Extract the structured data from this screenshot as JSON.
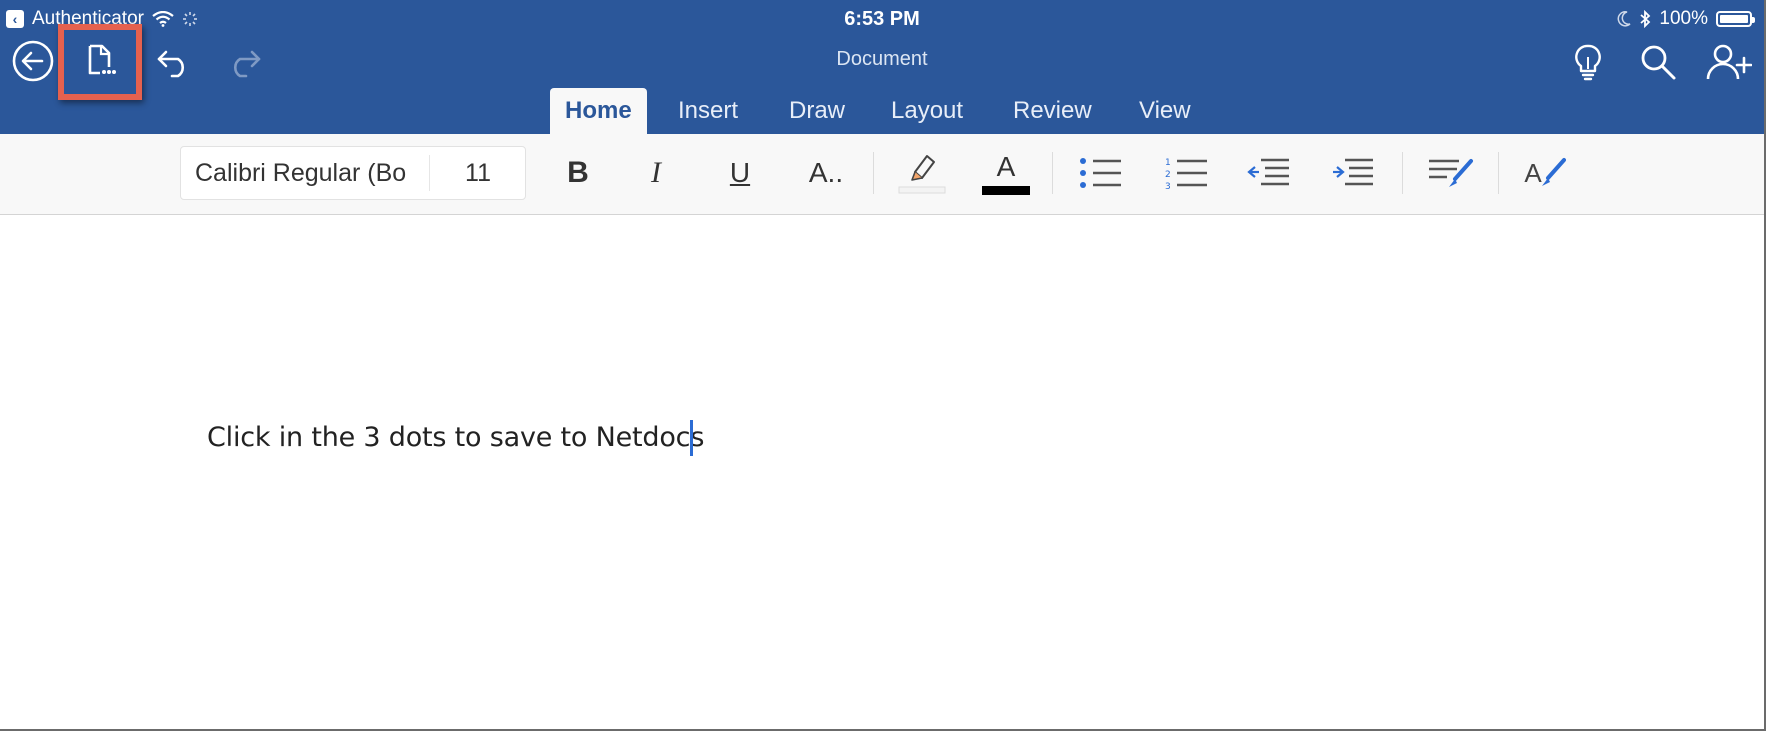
{
  "status_bar": {
    "back_app_label": "Authenticator",
    "time": "6:53 PM",
    "battery_percent": "100%"
  },
  "header": {
    "document_title": "Document",
    "icons": [
      "back-arrow-icon",
      "file-menu-icon",
      "undo-icon",
      "redo-icon",
      "tell-me-lightbulb-icon",
      "search-icon",
      "share-add-person-icon"
    ]
  },
  "tabs": [
    {
      "label": "Home",
      "active": true
    },
    {
      "label": "Insert",
      "active": false
    },
    {
      "label": "Draw",
      "active": false
    },
    {
      "label": "Layout",
      "active": false
    },
    {
      "label": "Review",
      "active": false
    },
    {
      "label": "View",
      "active": false
    }
  ],
  "ribbon": {
    "font_name": "Calibri Regular (Bo",
    "font_size": "11",
    "bold_glyph": "B",
    "italic_glyph": "I",
    "underline_glyph": "U",
    "more_format_glyph": "A..",
    "font_color_glyph": "A",
    "styles_glyph": "A"
  },
  "document": {
    "body_text": "Click in the 3 dots to save to Netdocs"
  },
  "colors": {
    "header_blue": "#2b579a",
    "highlight_box": "#e5614e",
    "caret": "#2b6cd4"
  }
}
